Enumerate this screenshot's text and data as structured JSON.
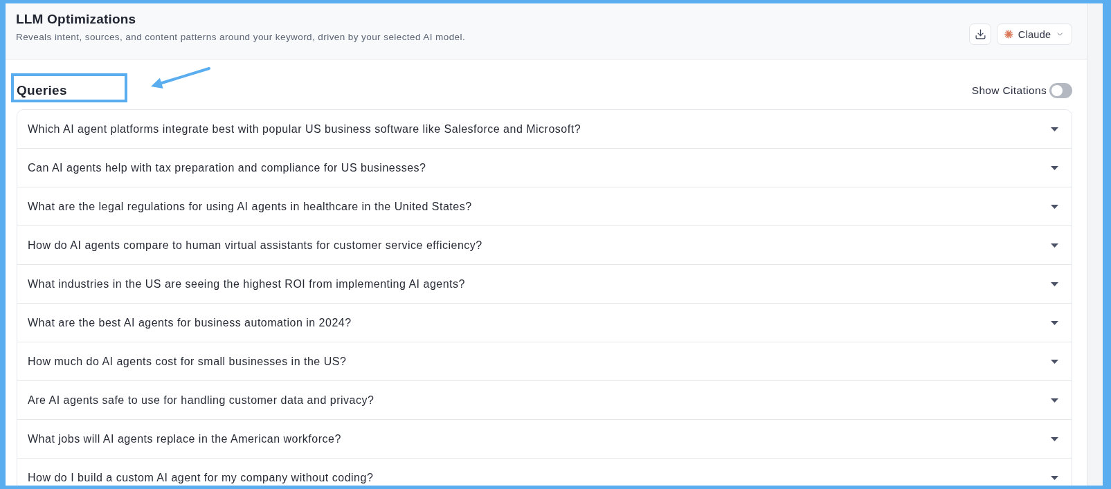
{
  "header": {
    "title": "LLM Optimizations",
    "subtitle": "Reveals intent, sources, and content patterns around your keyword, driven by your selected AI model.",
    "model_selector": {
      "label": "Claude"
    }
  },
  "annotation": {
    "kind": "callout"
  },
  "queries": {
    "title": "Queries",
    "show_citations": {
      "label": "Show Citations",
      "on": false
    },
    "items": [
      {
        "question": "Which AI agent platforms integrate best with popular US business software like Salesforce and Microsoft?",
        "expanded": false
      },
      {
        "question": "Can AI agents help with tax preparation and compliance for US businesses?",
        "expanded": false
      },
      {
        "question": "What are the legal regulations for using AI agents in healthcare in the United States?",
        "expanded": false
      },
      {
        "question": "How do AI agents compare to human virtual assistants for customer service efficiency?",
        "expanded": false
      },
      {
        "question": "What industries in the US are seeing the highest ROI from implementing AI agents?",
        "expanded": false
      },
      {
        "question": "What are the best AI agents for business automation in 2024?",
        "expanded": false
      },
      {
        "question": "How much do AI agents cost for small businesses in the US?",
        "expanded": false
      },
      {
        "question": "Are AI agents safe to use for handling customer data and privacy?",
        "expanded": false
      },
      {
        "question": "What jobs will AI agents replace in the American workforce?",
        "expanded": false
      },
      {
        "question": "How do I build a custom AI agent for my company without coding?",
        "expanded": false
      }
    ]
  }
}
